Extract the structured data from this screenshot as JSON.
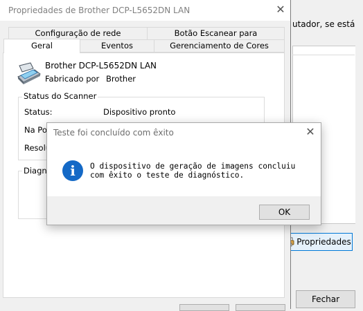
{
  "background_window": {
    "text_fragment": "utador, se está",
    "properties_button": "Propriedades",
    "close_button": "Fechar"
  },
  "properties_dialog": {
    "title": "Propriedades de Brother DCP-L5652DN LAN",
    "tabs": {
      "rede": "Configuração de rede",
      "scan": "Botão Escanear para",
      "geral": "Geral",
      "eventos": "Eventos",
      "cores": "Gerenciamento de Cores"
    },
    "device_name": "Brother DCP-L5652DN LAN",
    "manufacturer_label": "Fabricado por",
    "manufacturer_value": "Brother",
    "status_group": {
      "legend": "Status do Scanner",
      "status_label": "Status:",
      "status_value": "Dispositivo pronto",
      "port_label": "Na Por",
      "resolution_label": "Resolu"
    },
    "diagnostics_group": {
      "legend": "Diagnó"
    }
  },
  "message_box": {
    "title": "Teste foi concluído com êxito",
    "message": "O dispositivo de geração de imagens concluiu com êxito o teste de diagnóstico.",
    "ok_button": "OK",
    "icon": "info-icon",
    "info_glyph": "i"
  },
  "colors": {
    "accent": "#0078d7",
    "info_icon": "#1469c6"
  }
}
